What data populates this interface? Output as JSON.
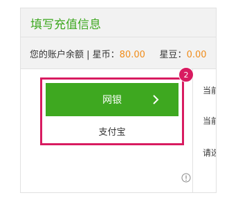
{
  "panel": {
    "title": "填写充值信息",
    "balance_label": "您的账户余额 | 星币：",
    "star_coin_value": "80.00",
    "star_bean_label": "星豆：",
    "star_bean_value": "0.00"
  },
  "payment_methods": {
    "bank_label": "网银",
    "alipay_label": "支付宝",
    "step_badge": "2"
  },
  "side_labels": [
    "当前",
    "当前",
    "请选"
  ],
  "icons": {
    "bank_chevron": "chevron-right-icon",
    "info": "info-icon"
  },
  "colors": {
    "accent_green": "#3ea820",
    "highlight_pink": "#d81b60",
    "value_orange": "#f08c1a"
  }
}
